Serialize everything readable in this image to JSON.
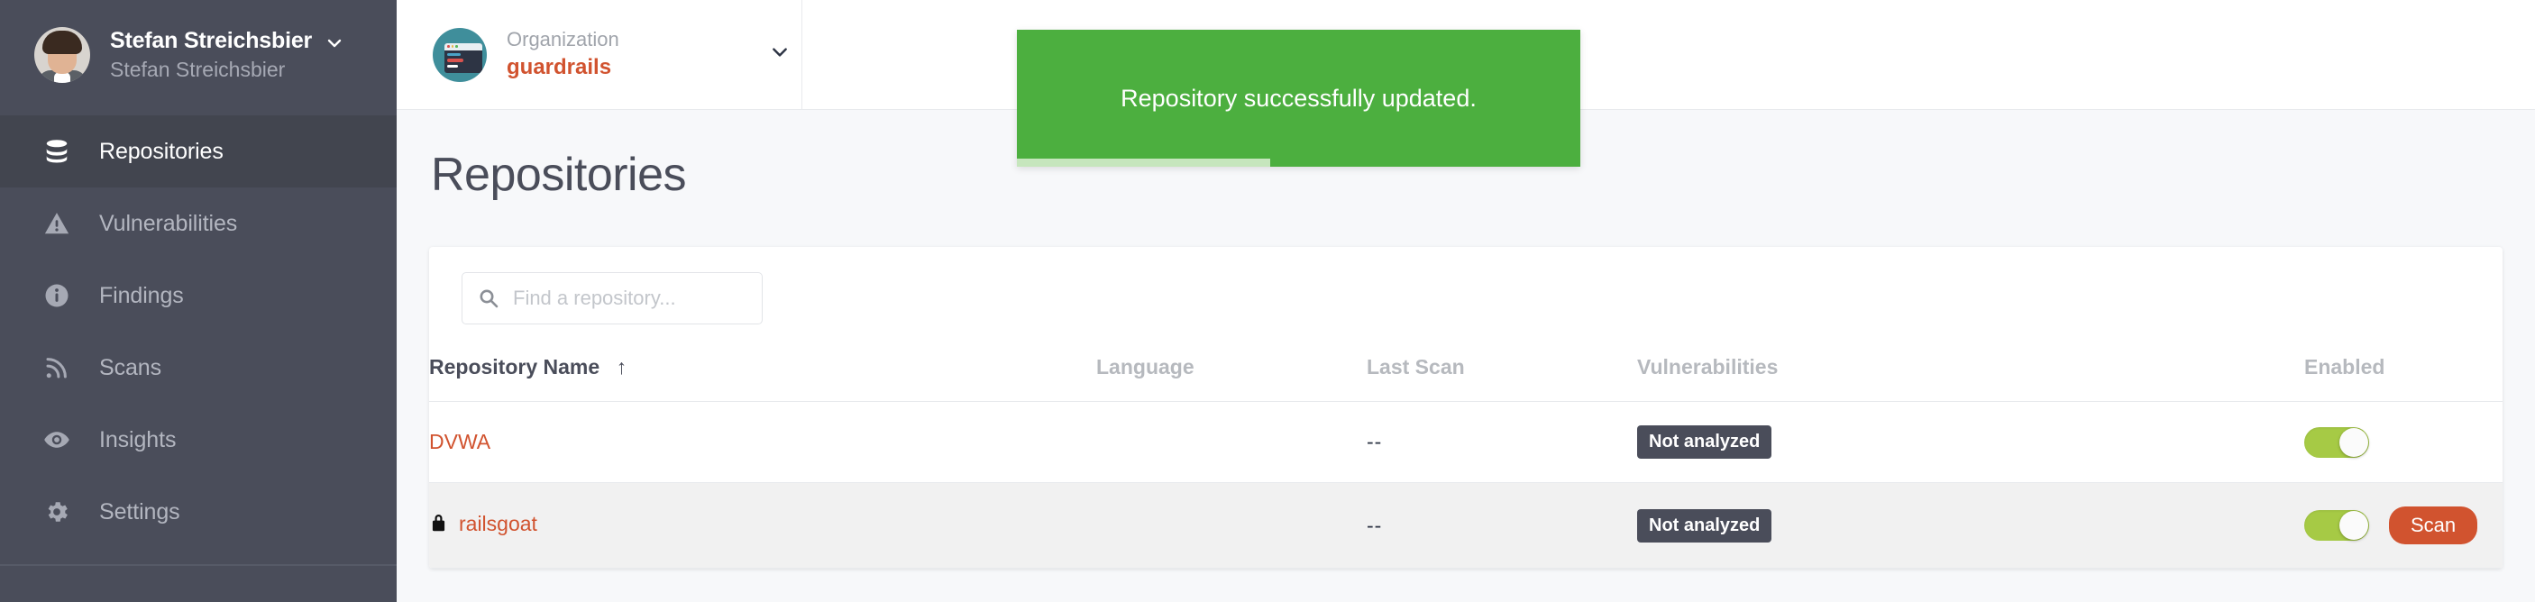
{
  "sidebar": {
    "profile": {
      "name": "Stefan Streichsbier",
      "subtitle": "Stefan Streichsbier",
      "avatar_icon": "user-avatar",
      "chevron_icon": "chevron-down-icon"
    },
    "items": [
      {
        "label": "Repositories",
        "icon": "database-icon",
        "active": true
      },
      {
        "label": "Vulnerabilities",
        "icon": "warning-triangle-icon",
        "active": false
      },
      {
        "label": "Findings",
        "icon": "info-circle-icon",
        "active": false
      },
      {
        "label": "Scans",
        "icon": "rss-signal-icon",
        "active": false
      },
      {
        "label": "Insights",
        "icon": "eye-icon",
        "active": false
      },
      {
        "label": "Settings",
        "icon": "gear-icon",
        "active": false
      }
    ]
  },
  "topbar": {
    "org": {
      "label": "Organization",
      "name": "guardrails",
      "avatar_icon": "organization-logo-icon",
      "chevron_icon": "chevron-down-icon"
    }
  },
  "toast": {
    "message": "Repository successfully updated.",
    "color": "#4caf3f",
    "progress_percent": 45
  },
  "main": {
    "title": "Repositories",
    "search": {
      "placeholder": "Find a repository...",
      "value": "",
      "icon": "search-icon"
    },
    "table": {
      "columns": [
        {
          "label": "Repository Name",
          "sorted": true,
          "sort_icon": "arrow-up-icon"
        },
        {
          "label": "Language",
          "sorted": false
        },
        {
          "label": "Last Scan",
          "sorted": false
        },
        {
          "label": "Vulnerabilities",
          "sorted": false
        },
        {
          "label": "Enabled",
          "sorted": false
        }
      ],
      "rows": [
        {
          "name": "DVWA",
          "private": false,
          "language": "",
          "last_scan": "--",
          "vulnerabilities": "Not analyzed",
          "enabled": true,
          "scan_label": "",
          "has_scan_button": false,
          "hovered": false
        },
        {
          "name": "railsgoat",
          "private": true,
          "lock_icon": "lock-icon",
          "language": "",
          "last_scan": "--",
          "vulnerabilities": "Not analyzed",
          "enabled": true,
          "scan_label": "Scan",
          "has_scan_button": true,
          "hovered": true
        }
      ]
    }
  },
  "colors": {
    "accent": "#d1532f",
    "sidebar_bg": "#4a4d5a",
    "toggle_on": "#a6ca45",
    "toast_green": "#4caf3f",
    "badge_bg": "#4a4d5a"
  }
}
